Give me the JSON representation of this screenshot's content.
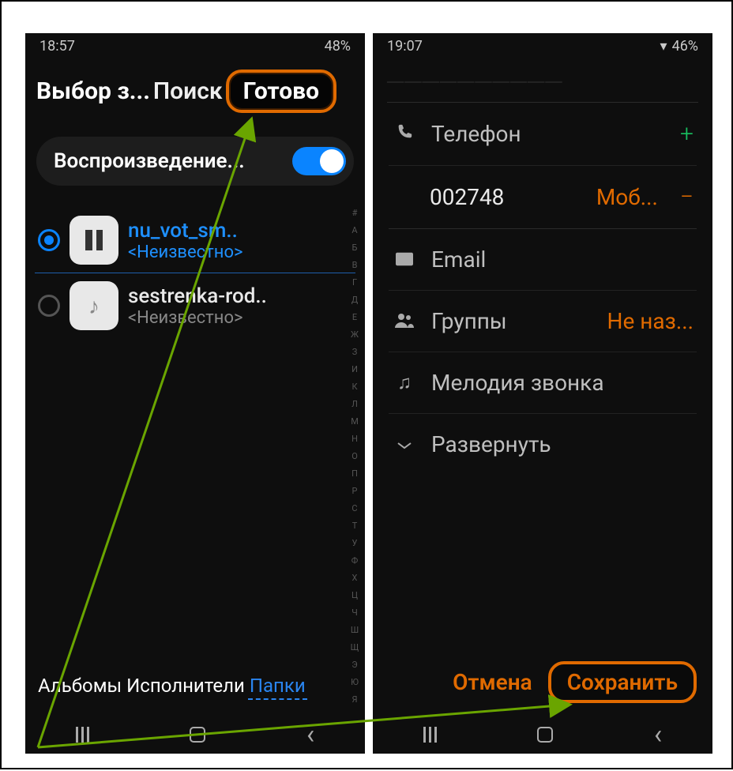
{
  "left": {
    "status_time": "18:57",
    "status_batt": "48%",
    "header_title": "Выбор з...",
    "header_search": "Поиск",
    "header_done": "Готово",
    "playbar_label": "Воспроизведение...",
    "tracks": [
      {
        "title": "nu_vot_sm..",
        "sub": "<Неизвестно>",
        "selected": true,
        "playing": true
      },
      {
        "title": "sestrenka-rod..",
        "sub": "<Неизвестно>",
        "selected": false,
        "playing": false
      }
    ],
    "tabs": {
      "albums": "Альбомы",
      "artists": "Исполнители",
      "folders": "Папки",
      "active": "folders"
    },
    "index_letters": [
      "#",
      "А",
      "Б",
      "В",
      "Г",
      "Д",
      "Е",
      "Ж",
      "З",
      "И",
      "К",
      "Л",
      "М",
      "Н",
      "О",
      "П",
      "Р",
      "С",
      "Т",
      "У",
      "Ф",
      "Х",
      "Ц",
      "Ч",
      "Ш",
      "Щ",
      "Э",
      "Ю",
      "Я"
    ]
  },
  "right": {
    "status_time": "19:07",
    "status_batt": "46%",
    "rows": {
      "phone_label": "Телефон",
      "phone_number": "002748",
      "phone_type": "Моб...",
      "email_label": "Email",
      "groups_label": "Группы",
      "groups_value": "Не наз...",
      "ringtone_label": "Мелодия звонка",
      "expand_label": "Развернуть"
    },
    "footer": {
      "cancel": "Отмена",
      "save": "Сохранить"
    }
  }
}
